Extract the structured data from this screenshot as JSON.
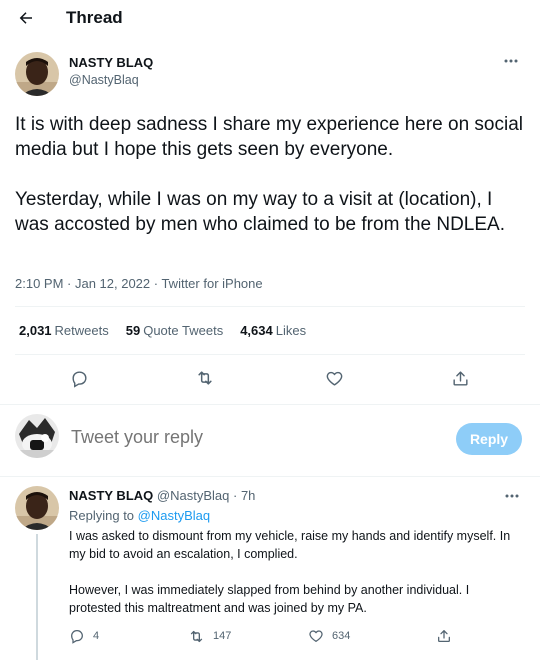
{
  "header": {
    "title": "Thread",
    "back_icon": "arrow-left-icon"
  },
  "tweet": {
    "author_name": "NASTY BLAQ",
    "author_handle": "@NastyBlaq",
    "paragraphs": [
      "It is with deep sadness I share my experience here on social media but I hope this gets seen by everyone.",
      "Yesterday, while I was on my way to a visit at (location), I was accosted by men who claimed to be from the NDLEA."
    ],
    "meta": "2:10 PM · Jan 12, 2022 · Twitter for iPhone",
    "retweets_count": "2,031",
    "retweets_label": "Retweets",
    "quotes_count": "59",
    "quotes_label": "Quote Tweets",
    "likes_count": "4,634",
    "likes_label": "Likes"
  },
  "reply_composer": {
    "placeholder": "Tweet your reply",
    "button_label": "Reply",
    "button_color": "#8ecdf8"
  },
  "reply": {
    "author_name": "NASTY BLAQ",
    "author_handle": "@NastyBlaq",
    "separator": "·",
    "time": "7h",
    "replying_prefix": "Replying to",
    "replying_to": "@NastyBlaq",
    "paragraphs": [
      "I was asked to dismount from my vehicle, raise my hands and identify myself. In my bid to avoid an escalation, I complied.",
      "However, I was immediately slapped from behind by another individual. I protested this maltreatment and was joined by my PA."
    ],
    "reply_count": "4",
    "retweet_count": "147",
    "like_count": "634"
  },
  "colors": {
    "accent": "#1d9bf0",
    "secondary_text": "#536471",
    "divider": "#eff3f4"
  }
}
